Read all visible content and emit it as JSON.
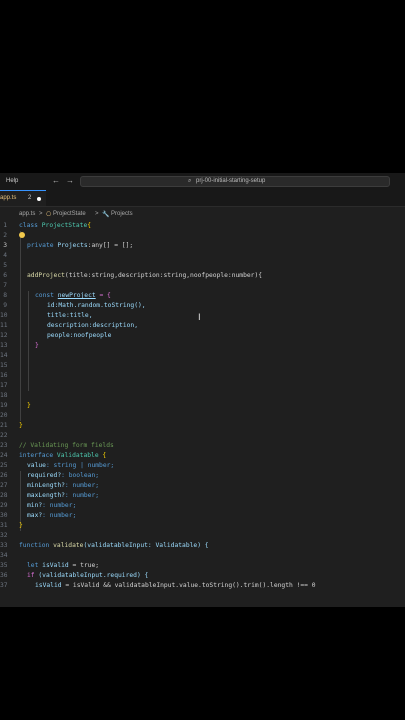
{
  "titlebar": {
    "menu_help": "Help",
    "back_icon": "←",
    "forward_icon": "→",
    "search_text": "prj-00-initial-starting-setup"
  },
  "tab": {
    "name": "app.ts",
    "problems": "2"
  },
  "breadcrumb": {
    "file": "app.ts",
    "sep": ">",
    "class": "ProjectState",
    "member": "Projects"
  },
  "code": {
    "line_numbers": [
      "1",
      "2",
      "3",
      "4",
      "5",
      "6",
      "7",
      "8",
      "9",
      "10",
      "11",
      "12",
      "13",
      "14",
      "15",
      "16",
      "17",
      "18",
      "19",
      "20",
      "21",
      "22",
      "23",
      "24",
      "25",
      "26",
      "27",
      "28",
      "29",
      "30",
      "31",
      "32",
      "33",
      "34",
      "35",
      "36",
      "37"
    ],
    "l1_kw": "class",
    "l1_name": "ProjectState",
    "l1_brace": "{",
    "l3_kw": "private",
    "l3_var": "Projects",
    "l3_rest": ":any[] = [];",
    "l6_fn": "addProject",
    "l6_params": "(title:string,description:string,noofpeople:number){",
    "l8_kw": "const",
    "l8_var": "newProject",
    "l8_rest": " = {",
    "l9": "id:Math.random.toString(),",
    "l10": "title:title,",
    "l11": "description:description,",
    "l12": "people:noofpeople",
    "l13": "}",
    "l19": "}",
    "l21": "}",
    "l23": "// Validating form fields",
    "l24_kw": "interface",
    "l24_name": "Validatable",
    "l24_brace": "{",
    "l25_a": "value",
    "l25_b": ": string | number;",
    "l26_a": "required?",
    "l26_b": ": boolean;",
    "l27_a": "minLength?",
    "l27_b": ": number;",
    "l28_a": "maxLength?",
    "l28_b": ": number;",
    "l29_a": "min?",
    "l29_b": ": number;",
    "l30_a": "max?",
    "l30_b": ": number;",
    "l31": "}",
    "l33_kw": "function",
    "l33_fn": "validate",
    "l33_param": "(validatableInput: Validatable) {",
    "l35_kw": "let",
    "l35_var": "isValid",
    "l35_rest": " = true;",
    "l36_kw": "if",
    "l36_rest": " (validatableInput.required) {",
    "l37_var": "isValid",
    "l37_rest": " = isValid && validatableInput.value.toString().trim().length !== 0"
  },
  "colors": {
    "accent": "#3794ff",
    "editor_bg": "#1f1f1f",
    "page_bg": "#000000"
  }
}
